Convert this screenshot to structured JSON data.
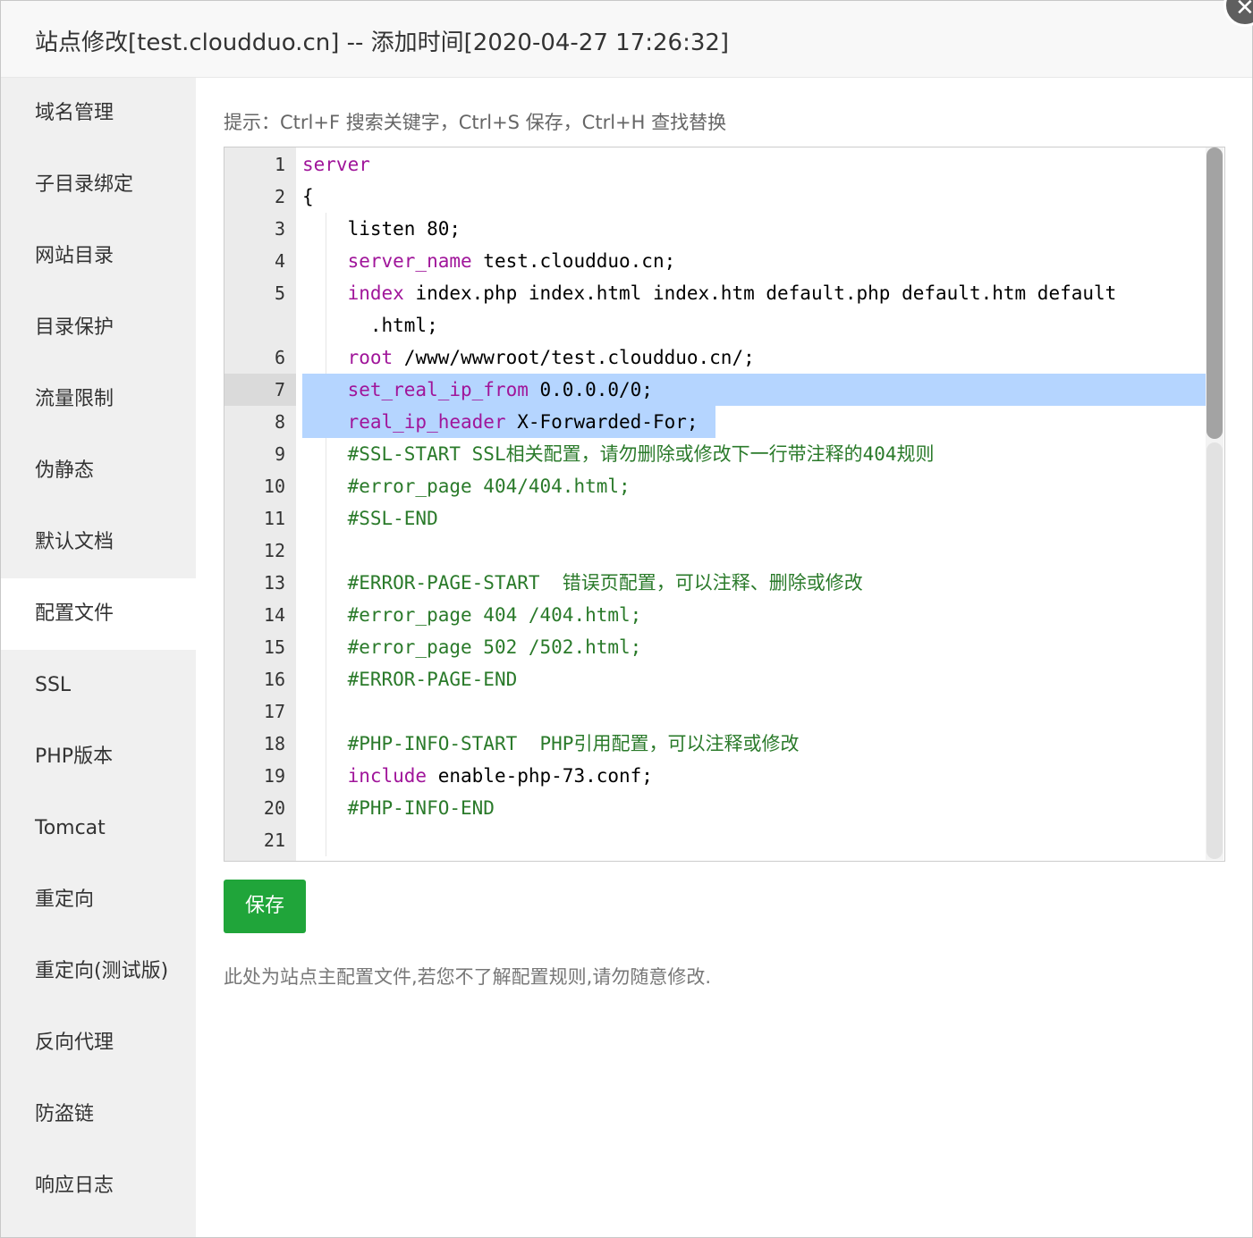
{
  "dialog": {
    "title": "站点修改[test.cloudduo.cn] -- 添加时间[2020-04-27 17:26:32]",
    "close_label": "✕"
  },
  "sidebar": {
    "items": [
      {
        "label": "域名管理",
        "active": false
      },
      {
        "label": "子目录绑定",
        "active": false
      },
      {
        "label": "网站目录",
        "active": false
      },
      {
        "label": "目录保护",
        "active": false
      },
      {
        "label": "流量限制",
        "active": false
      },
      {
        "label": "伪静态",
        "active": false
      },
      {
        "label": "默认文档",
        "active": false
      },
      {
        "label": "配置文件",
        "active": true
      },
      {
        "label": "SSL",
        "active": false
      },
      {
        "label": "PHP版本",
        "active": false
      },
      {
        "label": "Tomcat",
        "active": false
      },
      {
        "label": "重定向",
        "active": false
      },
      {
        "label": "重定向(测试版)",
        "active": false
      },
      {
        "label": "反向代理",
        "active": false
      },
      {
        "label": "防盗链",
        "active": false
      },
      {
        "label": "响应日志",
        "active": false
      }
    ]
  },
  "main": {
    "tip": "提示：Ctrl+F 搜索关键字，Ctrl+S 保存，Ctrl+H 查找替换",
    "editor": {
      "current_line": 7,
      "selected_lines": [
        7,
        8
      ],
      "lines": [
        {
          "n": "1",
          "parts": [
            {
              "t": "server",
              "c": "kw"
            }
          ]
        },
        {
          "n": "2",
          "parts": [
            {
              "t": "{",
              "c": ""
            }
          ]
        },
        {
          "n": "3",
          "parts": [
            {
              "t": "    listen 80;",
              "c": ""
            }
          ]
        },
        {
          "n": "4",
          "parts": [
            {
              "t": "    ",
              "c": ""
            },
            {
              "t": "server_name",
              "c": "kw"
            },
            {
              "t": " test.cloudduo.cn;",
              "c": ""
            }
          ]
        },
        {
          "n": "5",
          "parts": [
            {
              "t": "    ",
              "c": ""
            },
            {
              "t": "index",
              "c": "kw"
            },
            {
              "t": " index.php index.html index.htm default.php default.htm default",
              "c": ""
            }
          ]
        },
        {
          "n": "",
          "parts": [
            {
              "t": "      .html;",
              "c": ""
            }
          ]
        },
        {
          "n": "6",
          "parts": [
            {
              "t": "    ",
              "c": ""
            },
            {
              "t": "root",
              "c": "kw"
            },
            {
              "t": " /www/wwwroot/test.cloudduo.cn/;",
              "c": ""
            }
          ]
        },
        {
          "n": "7",
          "parts": [
            {
              "t": "    ",
              "c": ""
            },
            {
              "t": "set_real_ip_from",
              "c": "kw"
            },
            {
              "t": " 0.0.0.0/0;",
              "c": ""
            }
          ]
        },
        {
          "n": "8",
          "parts": [
            {
              "t": "    ",
              "c": ""
            },
            {
              "t": "real_ip_header",
              "c": "kw"
            },
            {
              "t": " X-Forwarded-For;",
              "c": ""
            }
          ]
        },
        {
          "n": "9",
          "parts": [
            {
              "t": "    ",
              "c": ""
            },
            {
              "t": "#SSL-START SSL相关配置，请勿删除或修改下一行带注释的404规则",
              "c": "cm"
            }
          ]
        },
        {
          "n": "10",
          "parts": [
            {
              "t": "    ",
              "c": ""
            },
            {
              "t": "#error_page 404/404.html;",
              "c": "cm"
            }
          ]
        },
        {
          "n": "11",
          "parts": [
            {
              "t": "    ",
              "c": ""
            },
            {
              "t": "#SSL-END",
              "c": "cm"
            }
          ]
        },
        {
          "n": "12",
          "parts": [
            {
              "t": "",
              "c": ""
            }
          ]
        },
        {
          "n": "13",
          "parts": [
            {
              "t": "    ",
              "c": ""
            },
            {
              "t": "#ERROR-PAGE-START  错误页配置，可以注释、删除或修改",
              "c": "cm"
            }
          ]
        },
        {
          "n": "14",
          "parts": [
            {
              "t": "    ",
              "c": ""
            },
            {
              "t": "#error_page 404 /404.html;",
              "c": "cm"
            }
          ]
        },
        {
          "n": "15",
          "parts": [
            {
              "t": "    ",
              "c": ""
            },
            {
              "t": "#error_page 502 /502.html;",
              "c": "cm"
            }
          ]
        },
        {
          "n": "16",
          "parts": [
            {
              "t": "    ",
              "c": ""
            },
            {
              "t": "#ERROR-PAGE-END",
              "c": "cm"
            }
          ]
        },
        {
          "n": "17",
          "parts": [
            {
              "t": "",
              "c": ""
            }
          ]
        },
        {
          "n": "18",
          "parts": [
            {
              "t": "    ",
              "c": ""
            },
            {
              "t": "#PHP-INFO-START  PHP引用配置，可以注释或修改",
              "c": "cm"
            }
          ]
        },
        {
          "n": "19",
          "parts": [
            {
              "t": "    ",
              "c": ""
            },
            {
              "t": "include",
              "c": "kw"
            },
            {
              "t": " enable-php-73.conf;",
              "c": ""
            }
          ]
        },
        {
          "n": "20",
          "parts": [
            {
              "t": "    ",
              "c": ""
            },
            {
              "t": "#PHP-INFO-END",
              "c": "cm"
            }
          ]
        },
        {
          "n": "21",
          "parts": [
            {
              "t": "",
              "c": ""
            }
          ]
        }
      ]
    },
    "save_label": "保存",
    "note": "此处为站点主配置文件,若您不了解配置规则,请勿随意修改."
  }
}
